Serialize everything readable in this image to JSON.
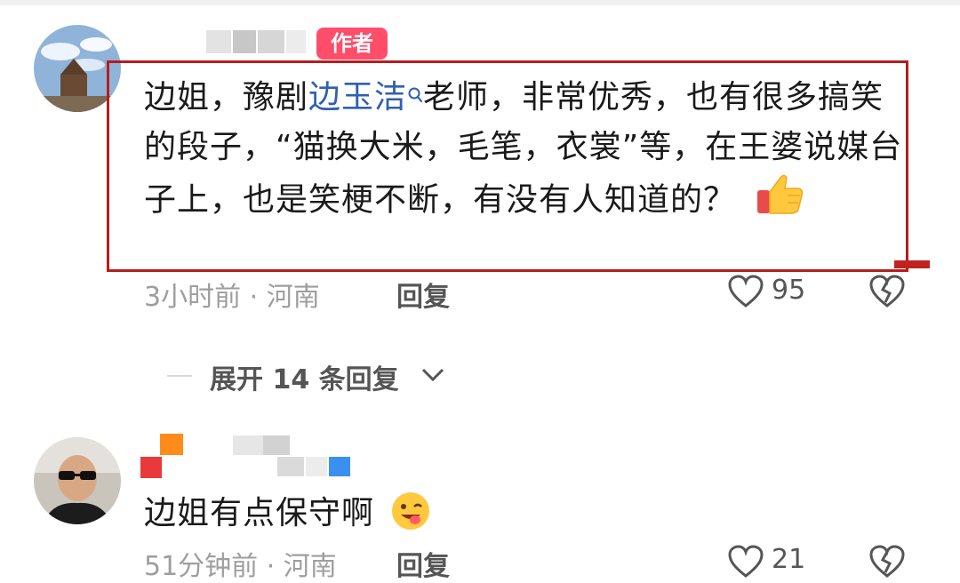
{
  "comment1": {
    "author_tag": "作者",
    "text_before": "边姐，豫剧",
    "keyword": "边玉洁",
    "text_after": "老师，非常优秀，也有很多搞笑的段子，“猫换大米，毛笔，衣裳”等，在王婆说媒台子上，也是笑梗不断，有没有人知道的？",
    "emoji": "thumbs-up-icon",
    "meta": "3小时前 · 河南",
    "reply_label": "回复",
    "like_count": "95"
  },
  "expand": {
    "label": "展开 14 条回复"
  },
  "comment2": {
    "text": "边姐有点保守啊",
    "emoji": "winking-tongue-face-icon",
    "meta": "51分钟前 · 河南",
    "reply_label": "回复",
    "like_count": "21"
  },
  "colors": {
    "keyword": "#2f5fb3",
    "author_tag_bg": "#ff4d6a",
    "highlight_box": "#b51d1d"
  }
}
